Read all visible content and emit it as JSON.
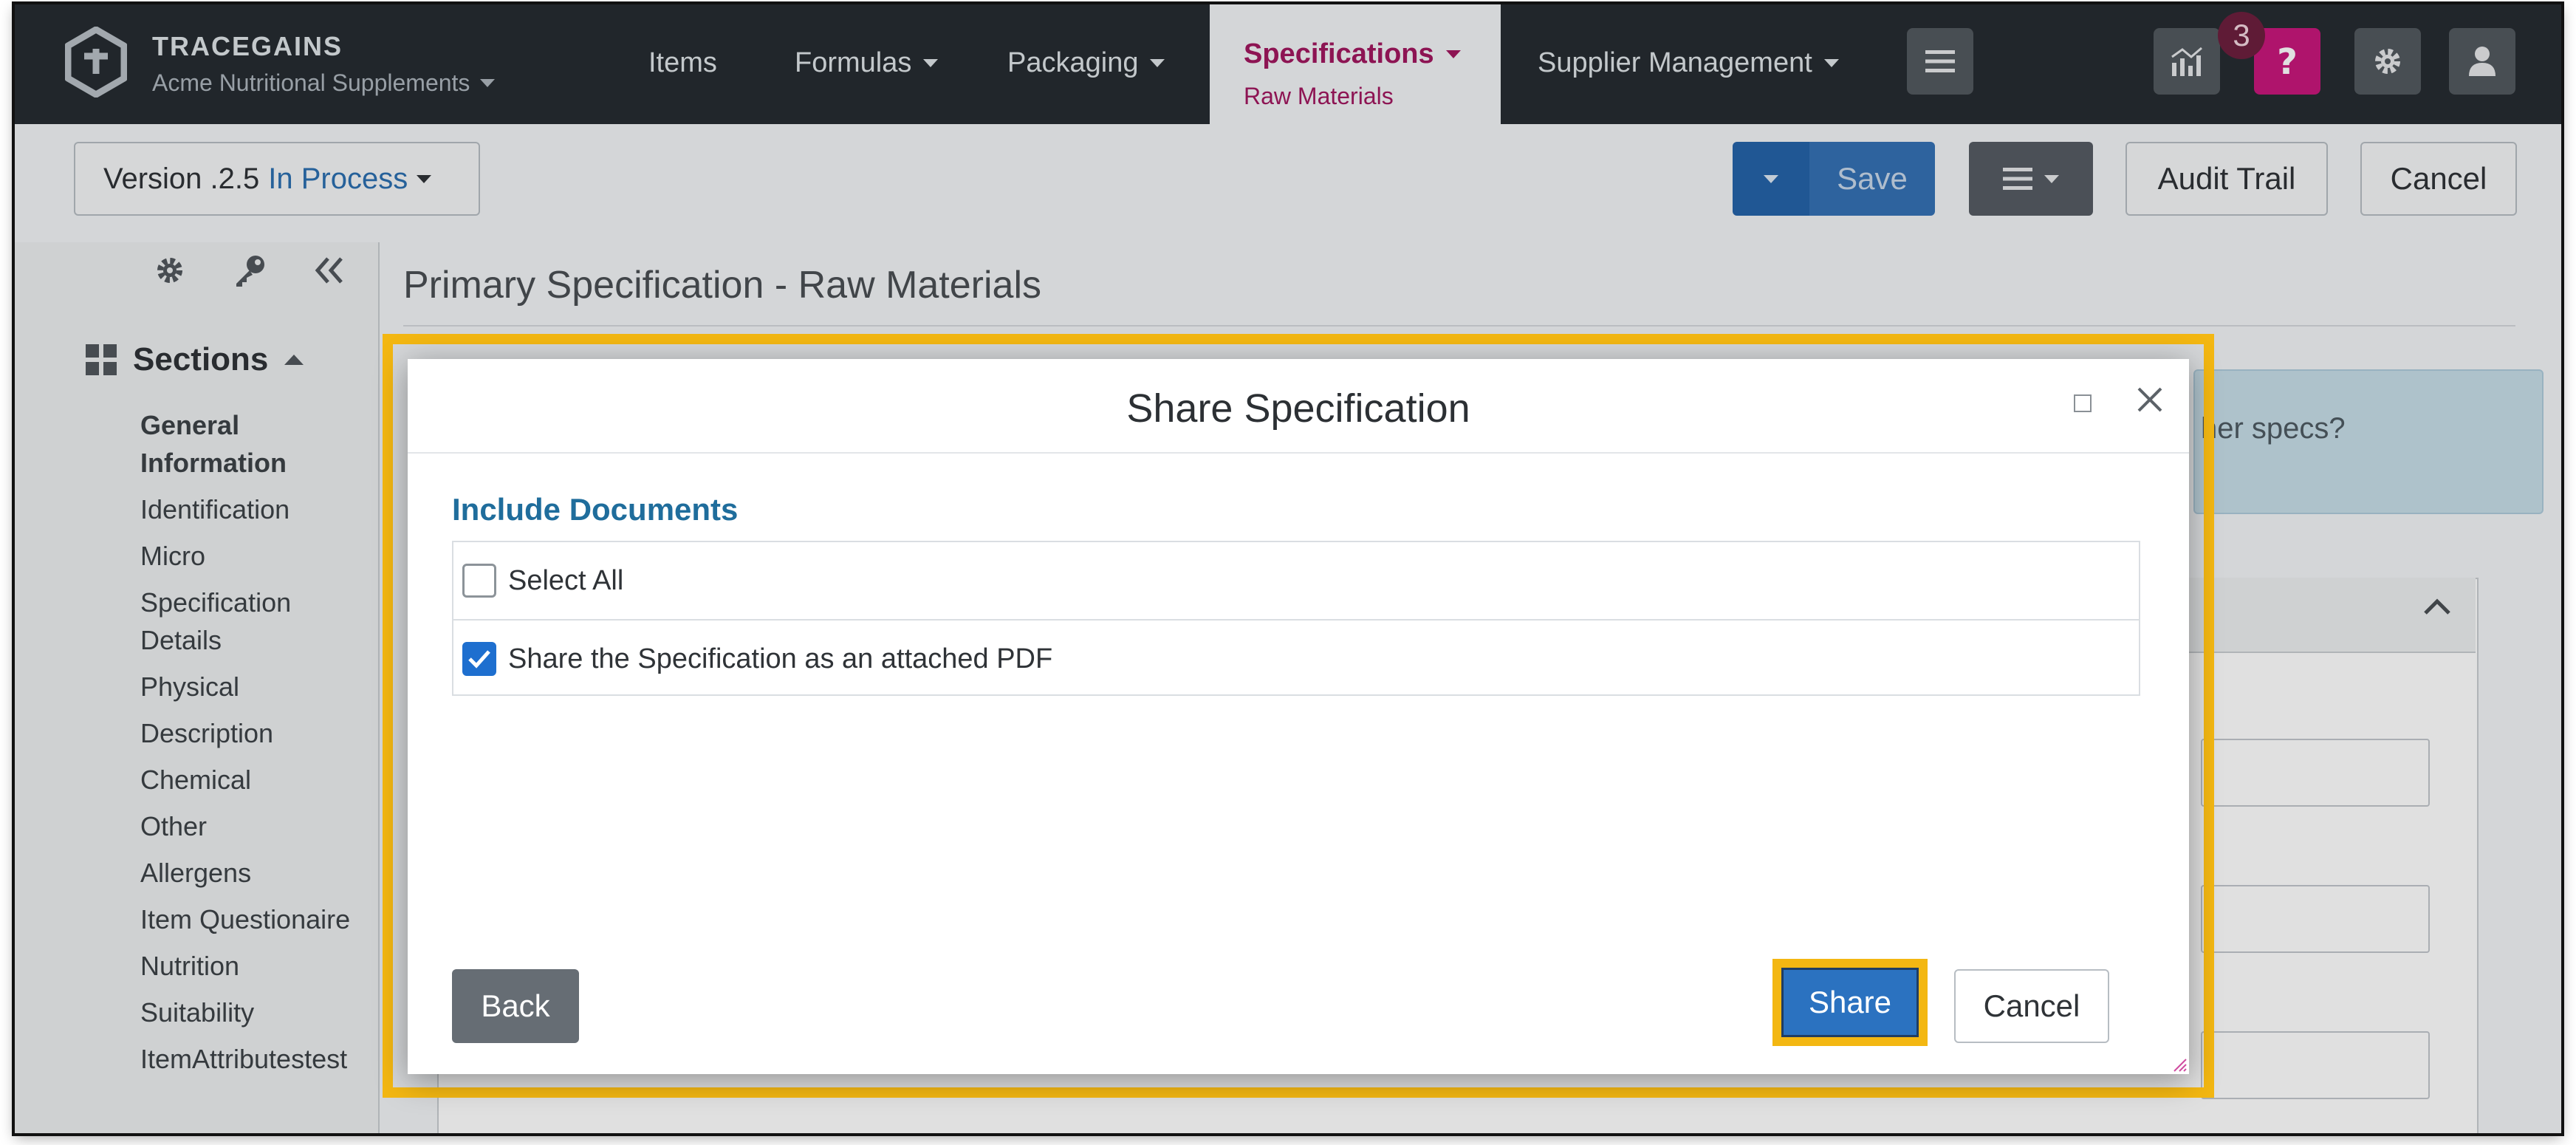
{
  "brand": {
    "name": "TRACEGAINS",
    "org": "Acme Nutritional Supplements"
  },
  "nav": {
    "items": [
      "Items",
      "Formulas",
      "Packaging"
    ],
    "active": {
      "label": "Specifications",
      "sub": "Raw Materials"
    },
    "supplier": "Supplier Management",
    "notification_count": "3",
    "help_color": "#c8177c"
  },
  "toolbar": {
    "version": "Version .2.5",
    "version_status": "In Process",
    "save": "Save",
    "audit_trail": "Audit Trail",
    "cancel": "Cancel"
  },
  "sidebar": {
    "sections_title": "Sections",
    "items": [
      "General Information",
      "Identification",
      "Micro",
      "Specification Details",
      "Physical",
      "Description",
      "Chemical",
      "Other",
      "Allergens",
      "Item Questionaire",
      "Nutrition",
      "Suitability",
      "ItemAttributestest"
    ]
  },
  "page": {
    "title": "Primary Specification - Raw Materials",
    "banner_partial": "her specs?"
  },
  "modal": {
    "title": "Share Specification",
    "section_label": "Include Documents",
    "options": [
      {
        "label": "Select All",
        "checked": false
      },
      {
        "label": "Share the Specification as an attached PDF",
        "checked": true
      }
    ],
    "back": "Back",
    "share": "Share",
    "cancel": "Cancel",
    "highlight_color": "#f3b712"
  }
}
